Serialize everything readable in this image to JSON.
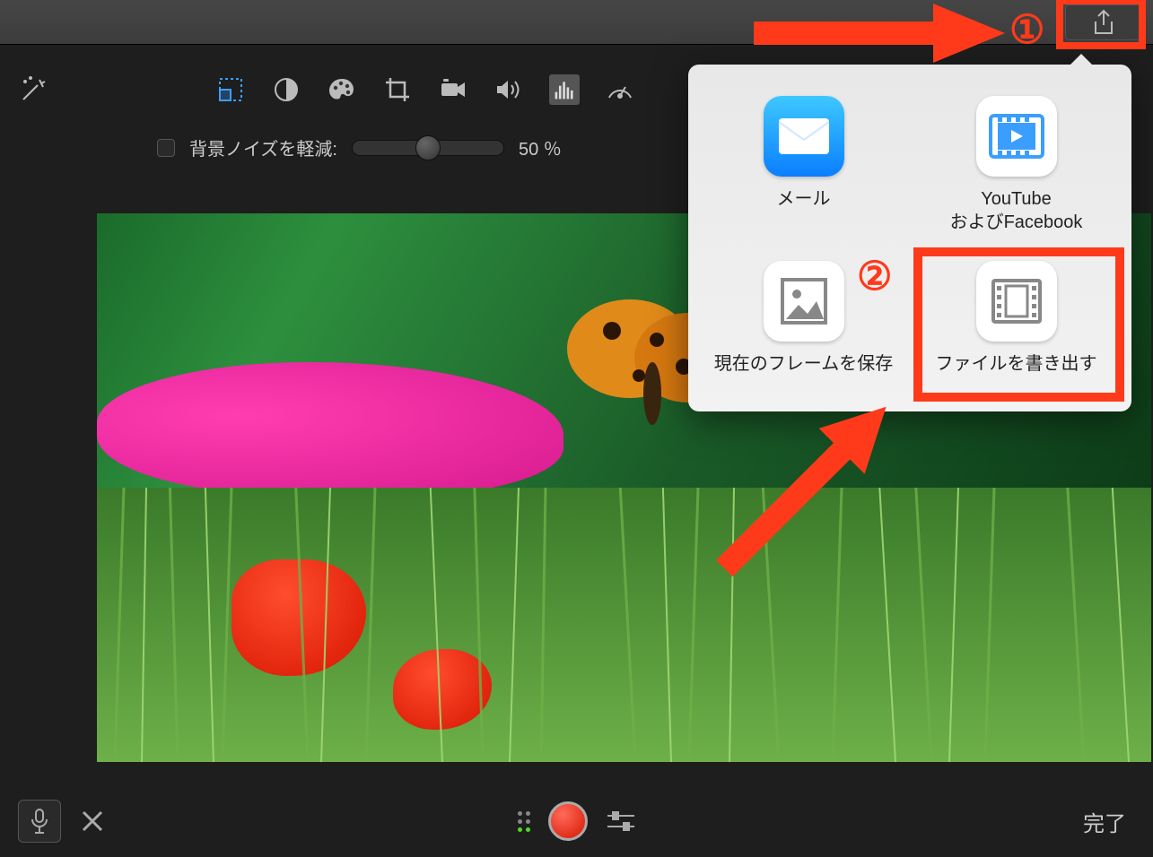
{
  "toolbar": {
    "noise_label": "背景ノイズを軽減:",
    "noise_value": "50 ％"
  },
  "share_popover": {
    "items": [
      {
        "label": "メール"
      },
      {
        "label": "YouTube\nおよびFacebook"
      },
      {
        "label": "現在のフレームを保存"
      },
      {
        "label": "ファイルを書き出す"
      }
    ]
  },
  "footer": {
    "done_label": "完了"
  },
  "annotations": {
    "num1": "①",
    "num2": "②"
  }
}
